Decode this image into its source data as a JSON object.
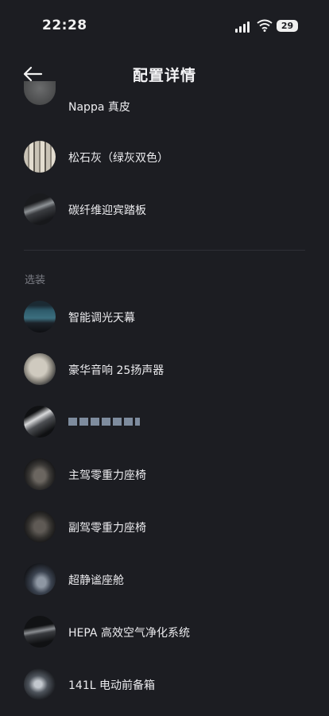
{
  "status": {
    "time": "22:28",
    "battery": "29"
  },
  "header": {
    "title": "配置详情"
  },
  "items_top": [
    {
      "label": "Nappa 真皮"
    },
    {
      "label": "松石灰（绿灰双色）"
    },
    {
      "label": "碳纤维迎宾踏板"
    }
  ],
  "optional": {
    "section_title": "选装",
    "items": [
      {
        "label": "智能调光天幕"
      },
      {
        "label": "豪华音响 25扬声器"
      },
      {
        "label": ""
      },
      {
        "label": "主驾零重力座椅"
      },
      {
        "label": "副驾零重力座椅"
      },
      {
        "label": "超静谧座舱"
      },
      {
        "label": "HEPA 高效空气净化系统"
      },
      {
        "label": "141L 电动前备箱"
      }
    ]
  },
  "colors": {
    "background": "#1c1d22",
    "text": "#ececef",
    "section": "#7b7d85"
  }
}
